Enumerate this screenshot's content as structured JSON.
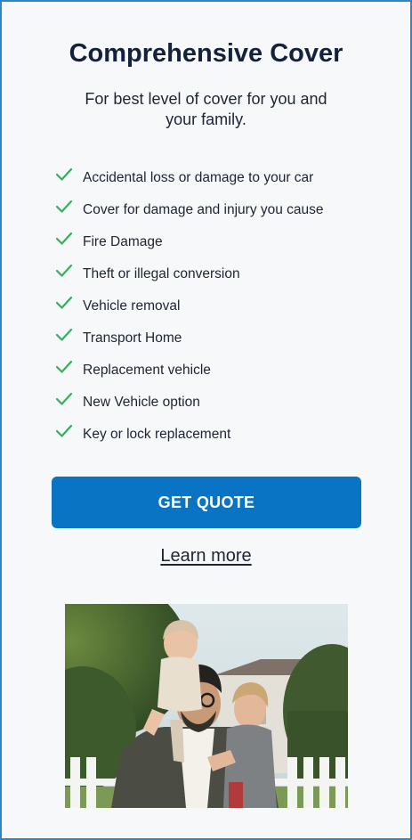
{
  "card": {
    "title": "Comprehensive Cover",
    "subtitle": "For best level of cover for you and your family."
  },
  "features": [
    {
      "label": "Accidental loss or damage to your car",
      "icon": "check-icon"
    },
    {
      "label": "Cover for damage and injury you cause",
      "icon": "check-icon"
    },
    {
      "label": "Fire Damage",
      "icon": "check-icon"
    },
    {
      "label": "Theft or illegal conversion",
      "icon": "check-icon"
    },
    {
      "label": "Vehicle removal",
      "icon": "check-icon"
    },
    {
      "label": "Transport Home",
      "icon": "check-icon"
    },
    {
      "label": "Replacement vehicle",
      "icon": "check-icon"
    },
    {
      "label": "New Vehicle option",
      "icon": "check-icon"
    },
    {
      "label": "Key or lock replacement",
      "icon": "check-icon"
    }
  ],
  "cta": {
    "label": "GET QUOTE"
  },
  "learn_more": {
    "label": "Learn more"
  },
  "colors": {
    "border": "#2e86c8",
    "title": "#14213a",
    "check": "#2fb35a",
    "cta_bg": "#0a74c4",
    "cta_text": "#ffffff"
  }
}
